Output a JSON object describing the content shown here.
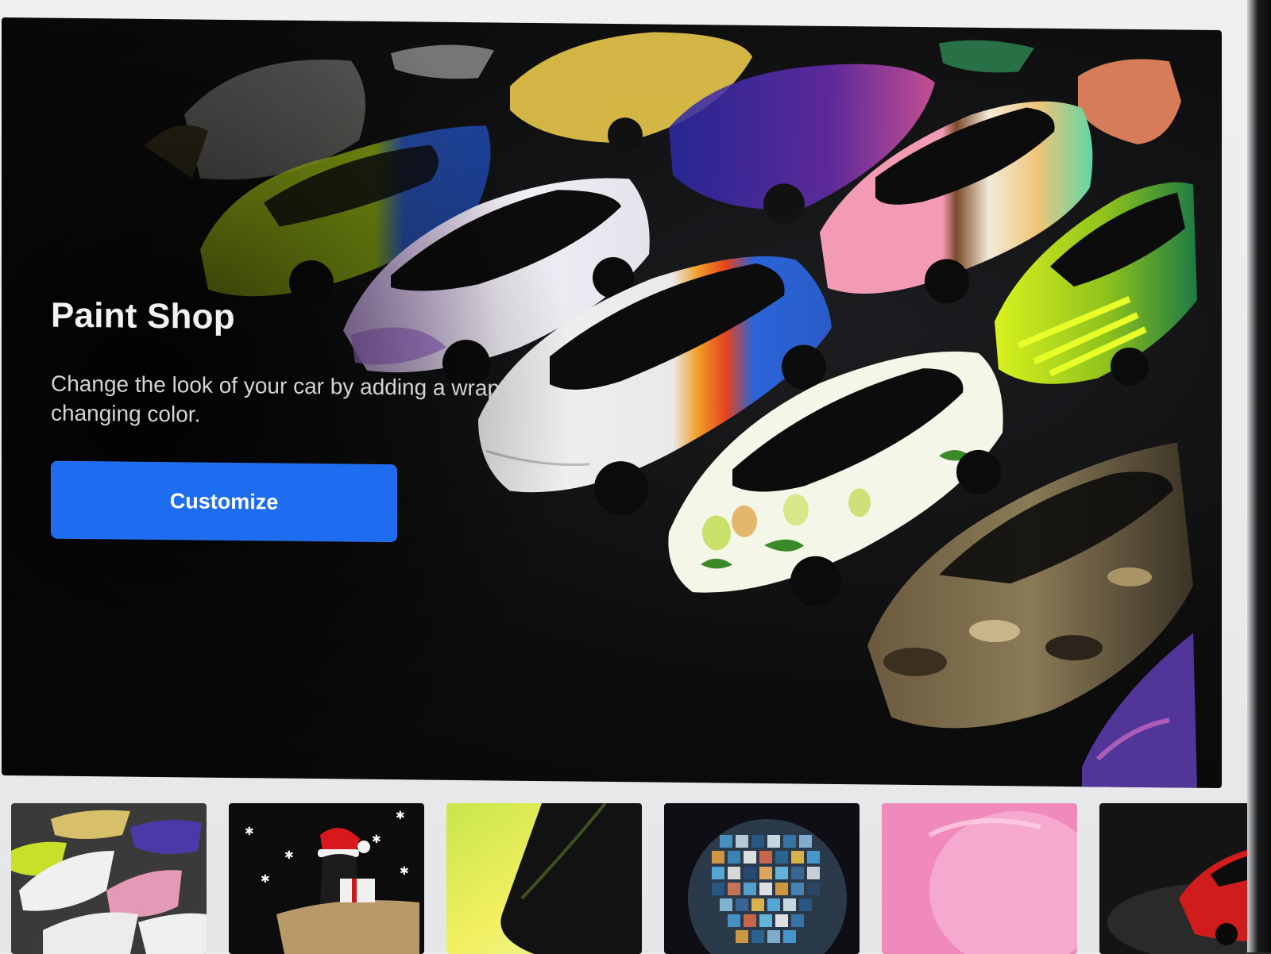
{
  "hero": {
    "title": "Paint Shop",
    "description": "Change the look of your car by adding a wrap or changing color.",
    "button_label": "Customize"
  },
  "colors": {
    "accent": "#1e6cf0",
    "hero_background": "#0d0d0e",
    "page_background": "#e9ebec"
  },
  "thumbnails": [
    {
      "name": "wrap-collection-thumbnail"
    },
    {
      "name": "holiday-thumbnail"
    },
    {
      "name": "gradient-wrap-thumbnail"
    },
    {
      "name": "disco-ball-thumbnail"
    },
    {
      "name": "pink-wrap-thumbnail"
    },
    {
      "name": "red-car-thumbnail"
    }
  ]
}
